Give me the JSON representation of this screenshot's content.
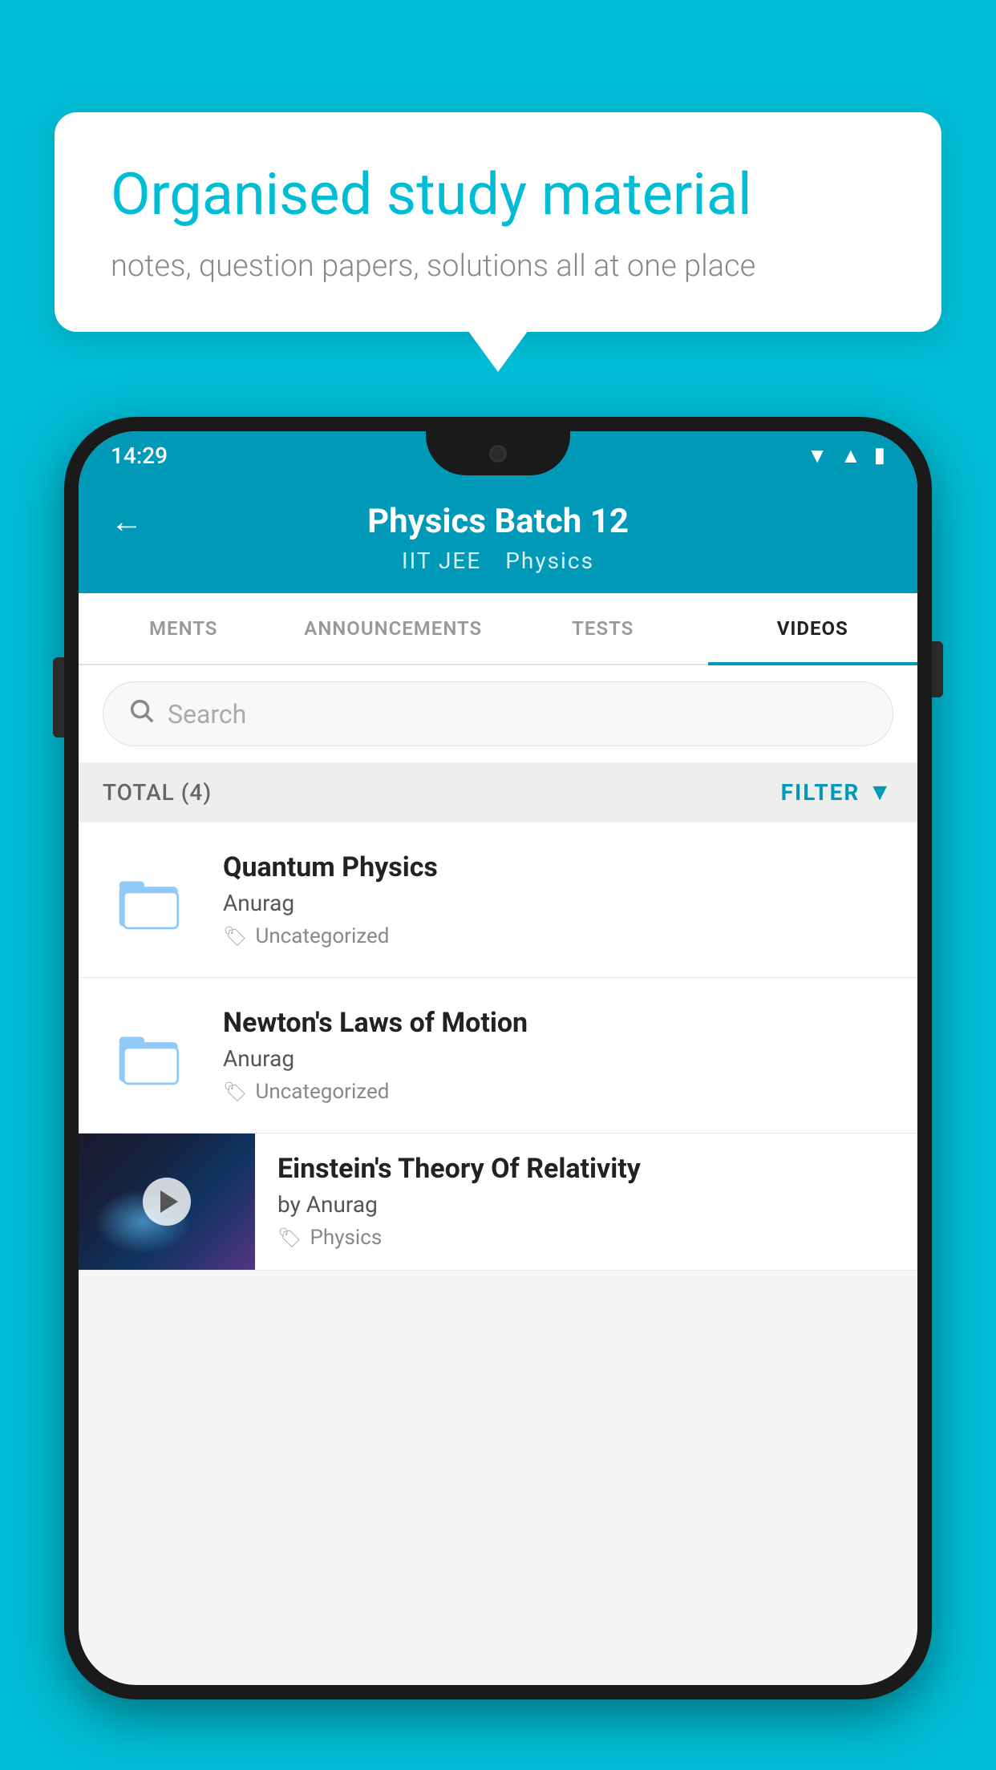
{
  "background_color": "#00bcd4",
  "speech_bubble": {
    "title": "Organised study material",
    "subtitle": "notes, question papers, solutions all at one place"
  },
  "status_bar": {
    "time": "14:29",
    "wifi_icon": "wifi",
    "signal_icon": "signal",
    "battery_icon": "battery"
  },
  "header": {
    "back_label": "←",
    "title": "Physics Batch 12",
    "tag1": "IIT JEE",
    "tag2": "Physics"
  },
  "tabs": [
    {
      "label": "MENTS",
      "active": false
    },
    {
      "label": "ANNOUNCEMENTS",
      "active": false
    },
    {
      "label": "TESTS",
      "active": false
    },
    {
      "label": "VIDEOS",
      "active": true
    }
  ],
  "search": {
    "placeholder": "Search"
  },
  "filter_bar": {
    "total_label": "TOTAL (4)",
    "filter_label": "FILTER"
  },
  "videos": [
    {
      "id": 1,
      "title": "Quantum Physics",
      "author": "Anurag",
      "tag": "Uncategorized",
      "has_thumbnail": false
    },
    {
      "id": 2,
      "title": "Newton's Laws of Motion",
      "author": "Anurag",
      "tag": "Uncategorized",
      "has_thumbnail": false
    },
    {
      "id": 3,
      "title": "Einstein's Theory Of Relativity",
      "author": "by Anurag",
      "tag": "Physics",
      "has_thumbnail": true
    }
  ]
}
